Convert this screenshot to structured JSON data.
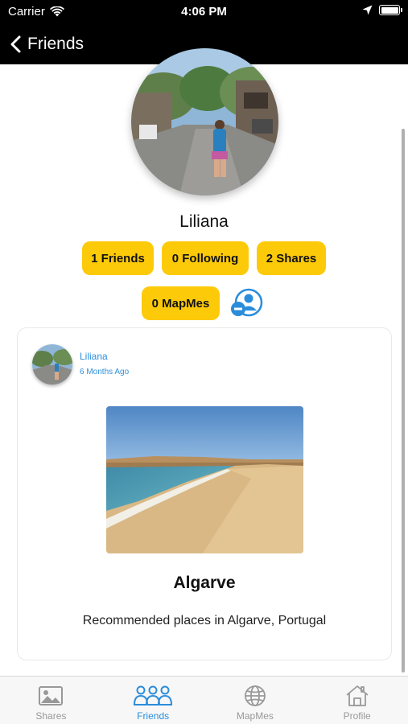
{
  "status_bar": {
    "carrier": "Carrier",
    "time": "4:06 PM"
  },
  "nav": {
    "back_title": "Friends"
  },
  "profile": {
    "name": "Liliana",
    "stats": {
      "friends": "1 Friends",
      "following": "0 Following",
      "shares": "2 Shares",
      "mapmes": "0 MapMes"
    }
  },
  "post": {
    "author": "Liliana",
    "time_ago": "6 Months Ago",
    "title": "Algarve",
    "description": "Recommended places in Algarve, Portugal"
  },
  "tabs": [
    {
      "label": "Shares",
      "icon": "photo-icon"
    },
    {
      "label": "Friends",
      "icon": "people-icon",
      "active": true
    },
    {
      "label": "MapMes",
      "icon": "globe-icon"
    },
    {
      "label": "Profile",
      "icon": "home-icon"
    }
  ],
  "colors": {
    "accent": "#2a8ddc",
    "stat_button": "#fdca0a",
    "bar": "#000000"
  }
}
